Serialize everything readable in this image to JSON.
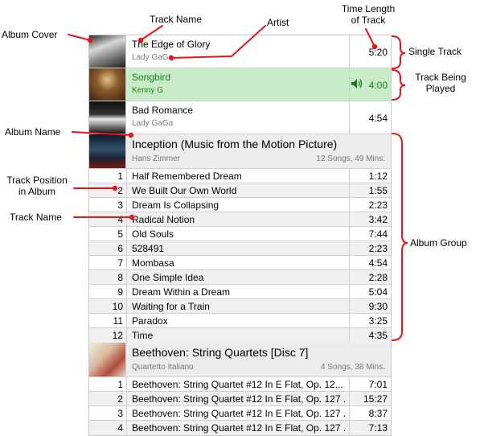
{
  "colors": {
    "annotation": "#e8141b",
    "playing_bg": "#c8ecc8",
    "playing_text": "#1f7a1f"
  },
  "annotations": {
    "album_cover": "Album Cover",
    "track_name_top": "Track Name",
    "artist": "Artist",
    "time_length_1": "Time Length",
    "time_length_2": "of Track",
    "single_track": "Single Track",
    "being_played_1": "Track Being",
    "being_played_2": "Played",
    "album_name": "Album Name",
    "track_position_1": "Track Position",
    "track_position_2": "in Album",
    "track_name_mid": "Track Name",
    "album_group": "Album Group"
  },
  "singles": [
    {
      "title": "The Edge of Glory",
      "artist": "Lady GaGa",
      "time": "5:20"
    },
    {
      "title": "Songbird",
      "artist": "Kenny G",
      "time": "4:00",
      "playing": true,
      "icon": "speaker-icon"
    },
    {
      "title": "Bad Romance",
      "artist": "Lady GaGa",
      "time": "4:54"
    }
  ],
  "albums": [
    {
      "title": "Inception (Music from the Motion Picture)",
      "artist": "Hans Zimmer",
      "meta": "12 Songs, 49 Mins.",
      "tracks": [
        {
          "n": "1",
          "name": "Half Remembered Dream",
          "time": "1:12"
        },
        {
          "n": "2",
          "name": "We Built Our Own World",
          "time": "1:55"
        },
        {
          "n": "3",
          "name": "Dream Is Collapsing",
          "time": "2:23"
        },
        {
          "n": "4",
          "name": "Radical Notion",
          "time": "3:42"
        },
        {
          "n": "5",
          "name": "Old Souls",
          "time": "7:44"
        },
        {
          "n": "6",
          "name": "528491",
          "time": "2:23"
        },
        {
          "n": "7",
          "name": "Mombasa",
          "time": "4:54"
        },
        {
          "n": "8",
          "name": "One Simple Idea",
          "time": "2:28"
        },
        {
          "n": "9",
          "name": "Dream Within a Dream",
          "time": "5:04"
        },
        {
          "n": "10",
          "name": "Waiting for a Train",
          "time": "9:30"
        },
        {
          "n": "11",
          "name": "Paradox",
          "time": "3:25"
        },
        {
          "n": "12",
          "name": "Time",
          "time": "4:35"
        }
      ]
    },
    {
      "title": "Beethoven: String Quartets [Disc 7]",
      "artist": "Quartetto Italiano",
      "meta": "4 Songs, 38 Mins.",
      "tracks": [
        {
          "n": "1",
          "name": "Beethoven: String Quartet #12 In E Flat, Op. 12...",
          "time": "7:01"
        },
        {
          "n": "2",
          "name": "Beethoven: String Quartet #12 In E Flat, Op. 127 .",
          "time": "15:27"
        },
        {
          "n": "3",
          "name": "Beethoven: String Quartet #12 In E Flat, Op. 127 .",
          "time": "8:37"
        },
        {
          "n": "4",
          "name": "Beethoven: String Quartet #12 In E Flat, Op. 127 .",
          "time": "7:13"
        }
      ]
    }
  ]
}
